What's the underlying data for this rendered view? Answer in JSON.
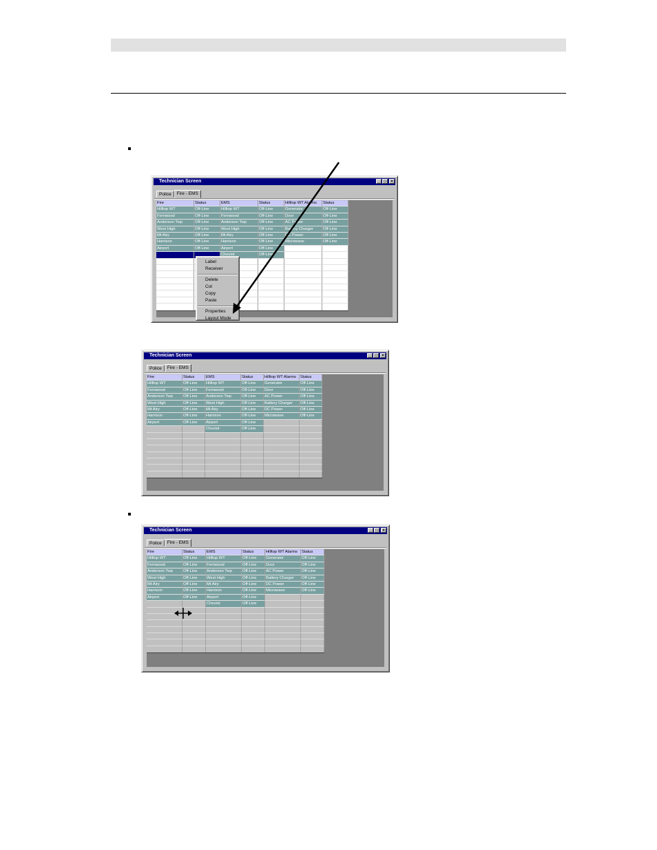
{
  "window": {
    "title": "Technician Screen",
    "min_glyph": "_",
    "max_glyph": "□",
    "close_glyph": "×"
  },
  "tabs": [
    "Police",
    "Fire - EMS"
  ],
  "grid": {
    "headers": [
      "Fire",
      "Status",
      "EMS",
      "Status",
      "Hilltop WT Alarms",
      "Status"
    ],
    "fire": [
      "Hilltop WT",
      "Fernwood",
      "Anderson Twp",
      "West High",
      "Mt Airy",
      "Harrison",
      "Airport"
    ],
    "ems": [
      "Hilltop WT",
      "Fernwood",
      "Anderson Twp",
      "West High",
      "Mt Airy",
      "Harrison",
      "Airport",
      "Cheviot"
    ],
    "alarms": [
      "Generator",
      "Door",
      "AC Power",
      "Battery Charger",
      "DC Power",
      "Microwave"
    ],
    "status_value": "Off-Line"
  },
  "context_menu": {
    "group1": [
      "Label",
      "Receiver"
    ],
    "group2": [
      "Delete",
      "Cut",
      "Copy",
      "Paste"
    ],
    "group3": [
      "Properties",
      "Layout Mode"
    ]
  },
  "colors": {
    "window_face": "#c0c0c0",
    "title_bar": "#000080",
    "header_row": "#c9c9f7",
    "data_cell": "#78a0a0",
    "client_area": "#808080"
  }
}
